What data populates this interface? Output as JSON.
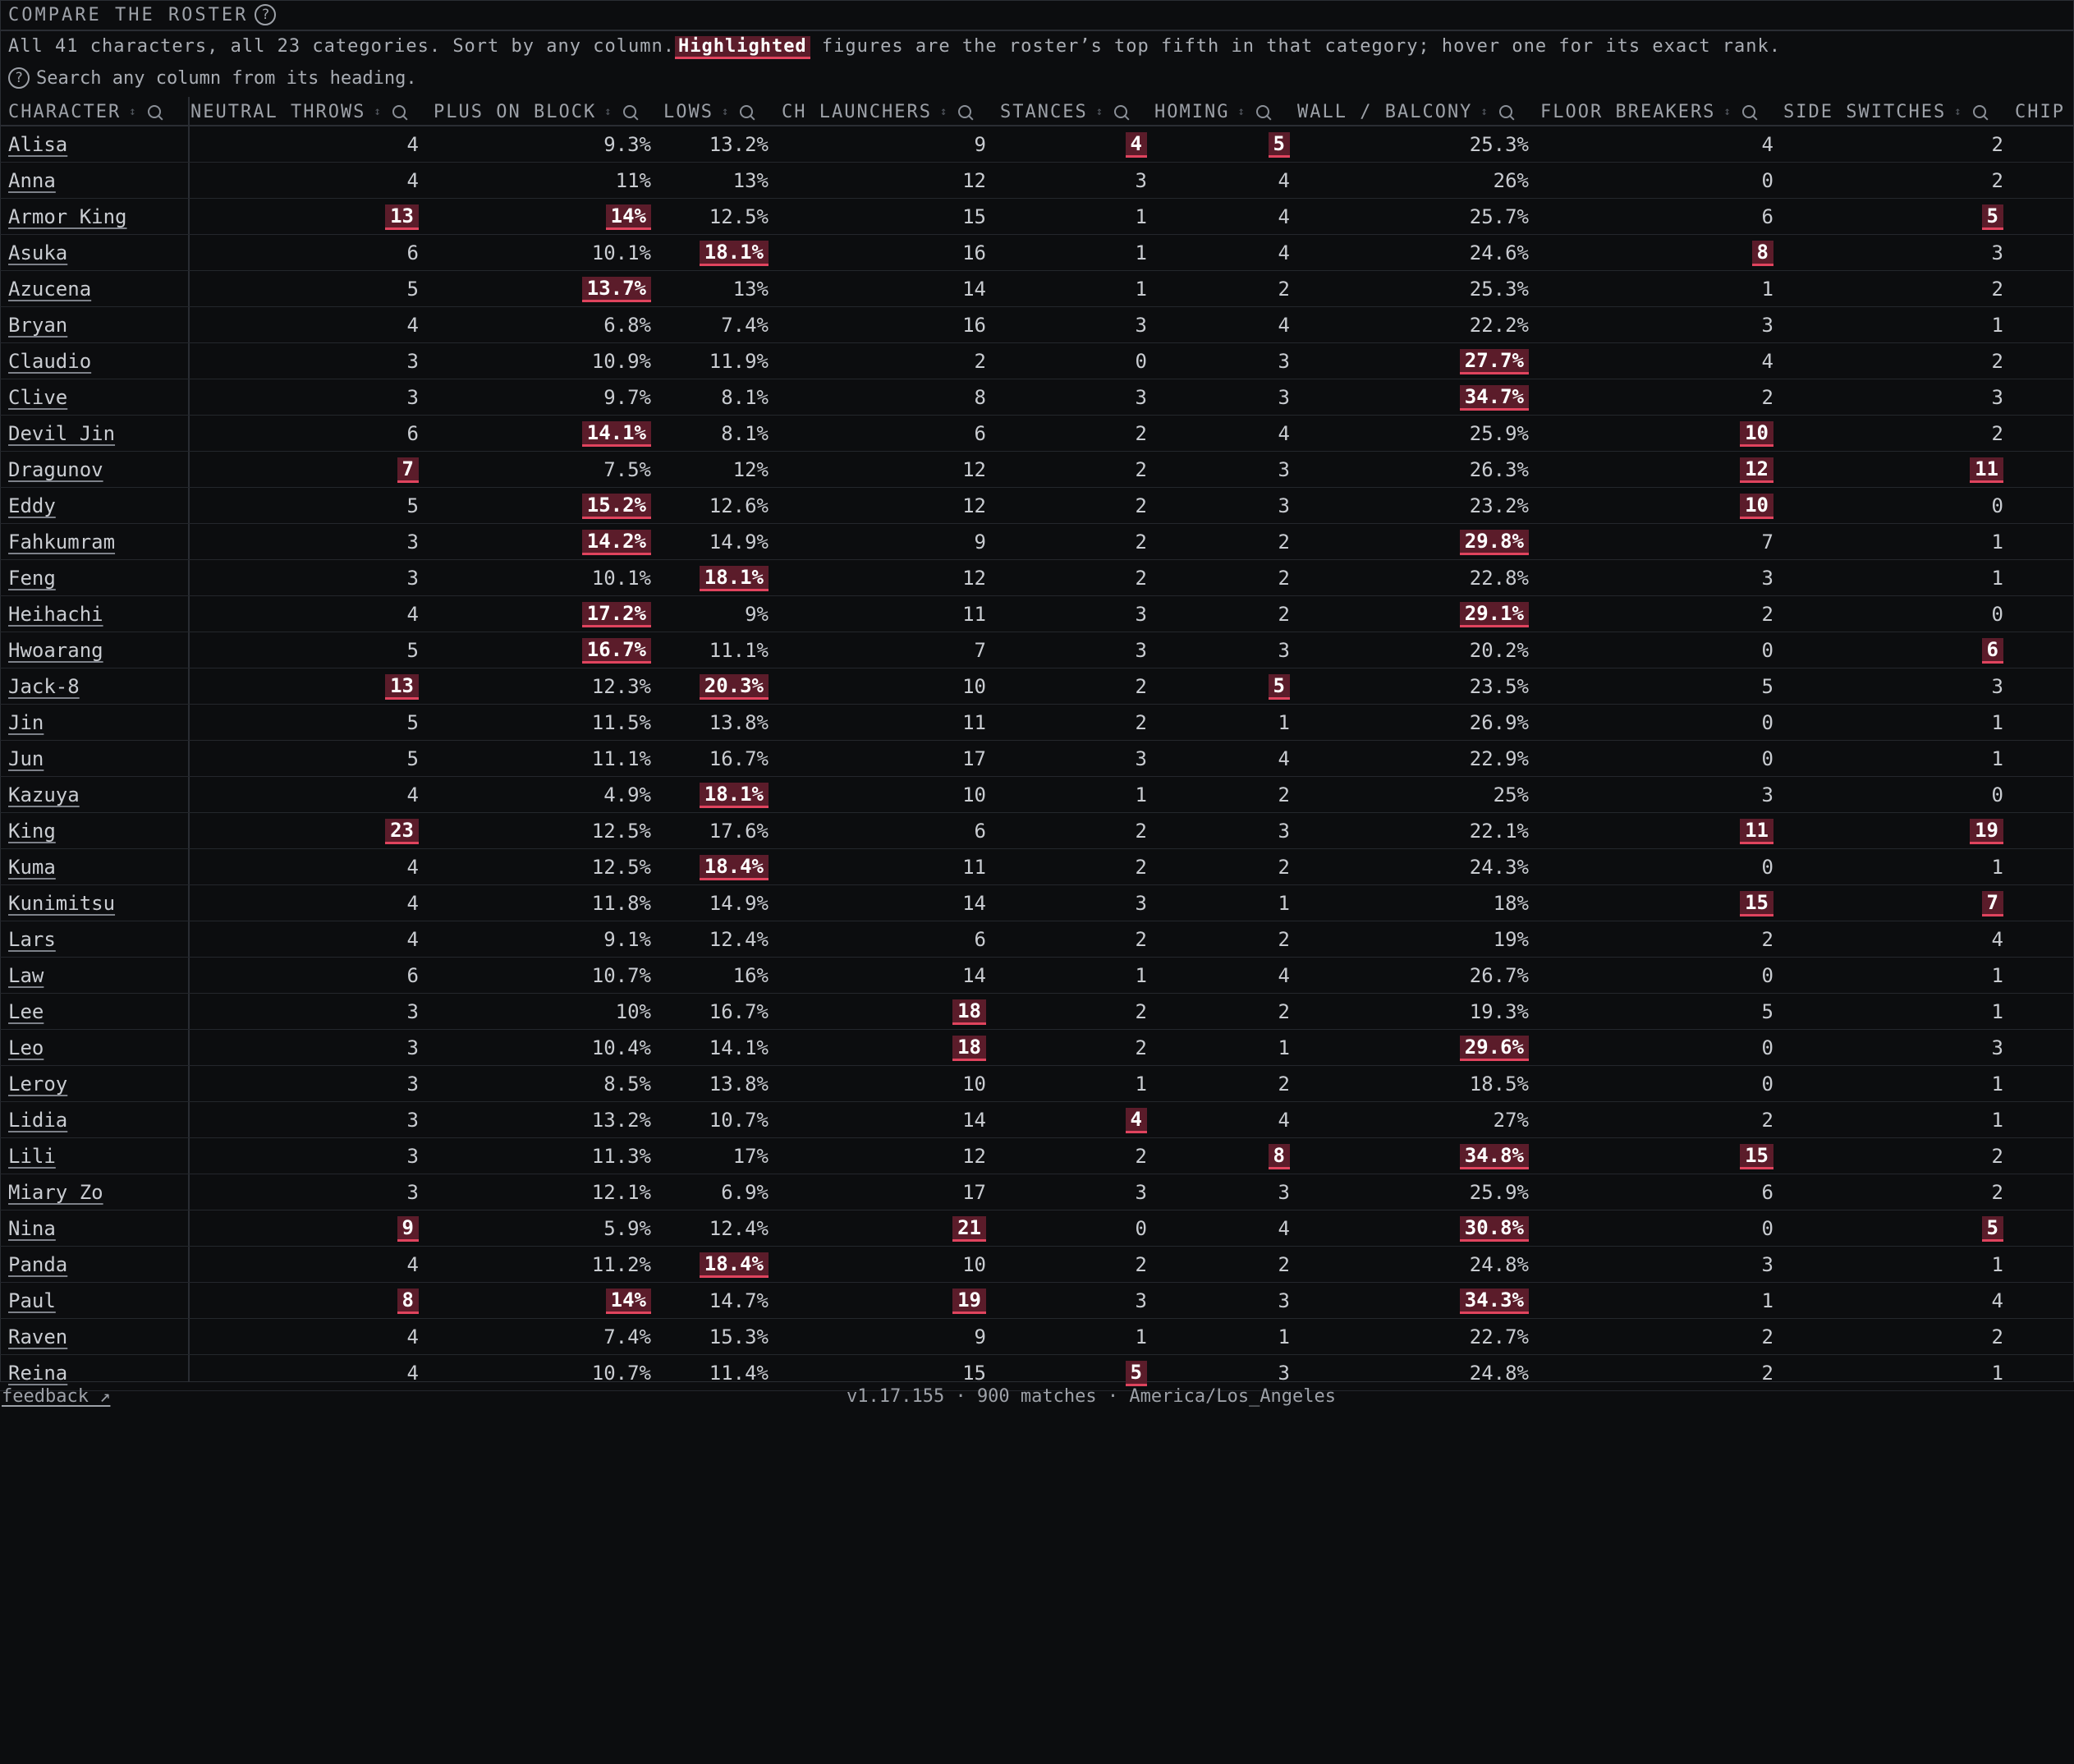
{
  "title": "COMPARE THE ROSTER",
  "help_glyph": "?",
  "description": {
    "before": "All 41 characters, all 23 categories. Sort by any column.",
    "highlight": "Highlighted",
    "after": " figures are the roster’s top fifth in that category; hover one for its exact rank."
  },
  "hint": "Search any column from its heading.",
  "columns": [
    "CHARACTER",
    "NEUTRAL THROWS",
    "PLUS ON BLOCK",
    "LOWS",
    "CH LAUNCHERS",
    "STANCES",
    "HOMING",
    "WALL / BALCONY",
    "FLOOR BREAKERS",
    "SIDE SWITCHES",
    "CHIP"
  ],
  "rows": [
    [
      "Alisa",
      "4",
      "9.3%",
      "13.2%",
      "9",
      "*4",
      "*5",
      "25.3%",
      "4",
      "2"
    ],
    [
      "Anna",
      "4",
      "11%",
      "13%",
      "12",
      "3",
      "4",
      "26%",
      "0",
      "2"
    ],
    [
      "Armor King",
      "*13",
      "*14%",
      "12.5%",
      "15",
      "1",
      "4",
      "25.7%",
      "6",
      "*5"
    ],
    [
      "Asuka",
      "6",
      "10.1%",
      "*18.1%",
      "16",
      "1",
      "4",
      "24.6%",
      "*8",
      "3"
    ],
    [
      "Azucena",
      "5",
      "*13.7%",
      "13%",
      "14",
      "1",
      "2",
      "25.3%",
      "1",
      "2"
    ],
    [
      "Bryan",
      "4",
      "6.8%",
      "7.4%",
      "16",
      "3",
      "4",
      "22.2%",
      "3",
      "1"
    ],
    [
      "Claudio",
      "3",
      "10.9%",
      "11.9%",
      "2",
      "0",
      "3",
      "*27.7%",
      "4",
      "2"
    ],
    [
      "Clive",
      "3",
      "9.7%",
      "8.1%",
      "8",
      "3",
      "3",
      "*34.7%",
      "2",
      "3"
    ],
    [
      "Devil Jin",
      "6",
      "*14.1%",
      "8.1%",
      "6",
      "2",
      "4",
      "25.9%",
      "*10",
      "2"
    ],
    [
      "Dragunov",
      "*7",
      "7.5%",
      "12%",
      "12",
      "2",
      "3",
      "26.3%",
      "*12",
      "*11"
    ],
    [
      "Eddy",
      "5",
      "*15.2%",
      "12.6%",
      "12",
      "2",
      "3",
      "23.2%",
      "*10",
      "0"
    ],
    [
      "Fahkumram",
      "3",
      "*14.2%",
      "14.9%",
      "9",
      "2",
      "2",
      "*29.8%",
      "7",
      "1"
    ],
    [
      "Feng",
      "3",
      "10.1%",
      "*18.1%",
      "12",
      "2",
      "2",
      "22.8%",
      "3",
      "1"
    ],
    [
      "Heihachi",
      "4",
      "*17.2%",
      "9%",
      "11",
      "3",
      "2",
      "*29.1%",
      "2",
      "0"
    ],
    [
      "Hwoarang",
      "5",
      "*16.7%",
      "11.1%",
      "7",
      "3",
      "3",
      "20.2%",
      "0",
      "*6"
    ],
    [
      "Jack-8",
      "*13",
      "12.3%",
      "*20.3%",
      "10",
      "2",
      "*5",
      "23.5%",
      "5",
      "3"
    ],
    [
      "Jin",
      "5",
      "11.5%",
      "13.8%",
      "11",
      "2",
      "1",
      "26.9%",
      "0",
      "1"
    ],
    [
      "Jun",
      "5",
      "11.1%",
      "16.7%",
      "17",
      "3",
      "4",
      "22.9%",
      "0",
      "1"
    ],
    [
      "Kazuya",
      "4",
      "4.9%",
      "*18.1%",
      "10",
      "1",
      "2",
      "25%",
      "3",
      "0"
    ],
    [
      "King",
      "*23",
      "12.5%",
      "17.6%",
      "6",
      "2",
      "3",
      "22.1%",
      "*11",
      "*19"
    ],
    [
      "Kuma",
      "4",
      "12.5%",
      "*18.4%",
      "11",
      "2",
      "2",
      "24.3%",
      "0",
      "1"
    ],
    [
      "Kunimitsu",
      "4",
      "11.8%",
      "14.9%",
      "14",
      "3",
      "1",
      "18%",
      "*15",
      "*7"
    ],
    [
      "Lars",
      "4",
      "9.1%",
      "12.4%",
      "6",
      "2",
      "2",
      "19%",
      "2",
      "4"
    ],
    [
      "Law",
      "6",
      "10.7%",
      "16%",
      "14",
      "1",
      "4",
      "26.7%",
      "0",
      "1"
    ],
    [
      "Lee",
      "3",
      "10%",
      "16.7%",
      "*18",
      "2",
      "2",
      "19.3%",
      "5",
      "1"
    ],
    [
      "Leo",
      "3",
      "10.4%",
      "14.1%",
      "*18",
      "2",
      "1",
      "*29.6%",
      "0",
      "3"
    ],
    [
      "Leroy",
      "3",
      "8.5%",
      "13.8%",
      "10",
      "1",
      "2",
      "18.5%",
      "0",
      "1"
    ],
    [
      "Lidia",
      "3",
      "13.2%",
      "10.7%",
      "14",
      "*4",
      "4",
      "27%",
      "2",
      "1"
    ],
    [
      "Lili",
      "3",
      "11.3%",
      "17%",
      "12",
      "2",
      "*8",
      "*34.8%",
      "*15",
      "2"
    ],
    [
      "Miary Zo",
      "3",
      "12.1%",
      "6.9%",
      "17",
      "3",
      "3",
      "25.9%",
      "6",
      "2"
    ],
    [
      "Nina",
      "*9",
      "5.9%",
      "12.4%",
      "*21",
      "0",
      "4",
      "*30.8%",
      "0",
      "*5"
    ],
    [
      "Panda",
      "4",
      "11.2%",
      "*18.4%",
      "10",
      "2",
      "2",
      "24.8%",
      "3",
      "1"
    ],
    [
      "Paul",
      "*8",
      "*14%",
      "14.7%",
      "*19",
      "3",
      "3",
      "*34.3%",
      "1",
      "4"
    ],
    [
      "Raven",
      "4",
      "7.4%",
      "15.3%",
      "9",
      "1",
      "1",
      "22.7%",
      "2",
      "2"
    ],
    [
      "Reina",
      "4",
      "10.7%",
      "11.4%",
      "15",
      "*5",
      "3",
      "24.8%",
      "2",
      "1"
    ]
  ],
  "footer": {
    "feedback": "feedback ↗",
    "info": "v1.17.155 · 900 matches · America/Los_Angeles"
  },
  "colors": {
    "highlight_bg": "#5b1c2a",
    "highlight_line": "#e0445e",
    "background": "#0c0d0f"
  }
}
